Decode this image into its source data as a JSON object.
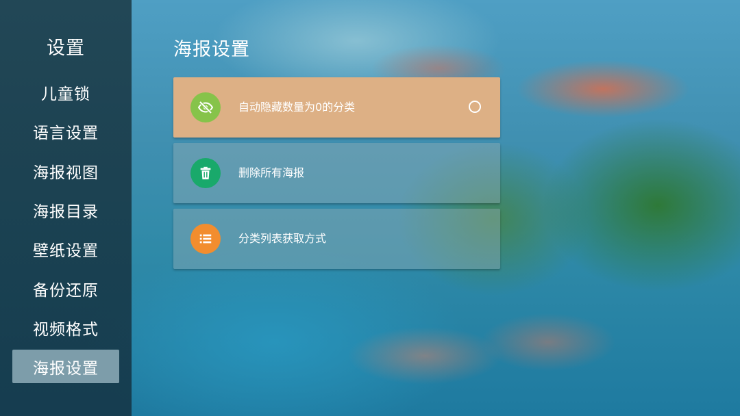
{
  "sidebar": {
    "title": "设置",
    "items": [
      {
        "label": "儿童锁"
      },
      {
        "label": "语言设置"
      },
      {
        "label": "海报视图"
      },
      {
        "label": "海报目录"
      },
      {
        "label": "壁纸设置"
      },
      {
        "label": "备份还原"
      },
      {
        "label": "视频格式"
      },
      {
        "label": "海报设置"
      }
    ],
    "active_item": "海报设置"
  },
  "main": {
    "title": "海报设置",
    "options": [
      {
        "label": "自动隐藏数量为0的分类",
        "icon": "eye-off-icon",
        "icon_color": "#86c34a",
        "selected": false,
        "focused": true
      },
      {
        "label": "删除所有海报",
        "icon": "trash-icon",
        "icon_color": "#19a96b"
      },
      {
        "label": "分类列表获取方式",
        "icon": "list-icon",
        "icon_color": "#f28d2e"
      }
    ]
  },
  "colors": {
    "focus_row": "#ddb085",
    "sidebar_active": "#a0bec8"
  }
}
